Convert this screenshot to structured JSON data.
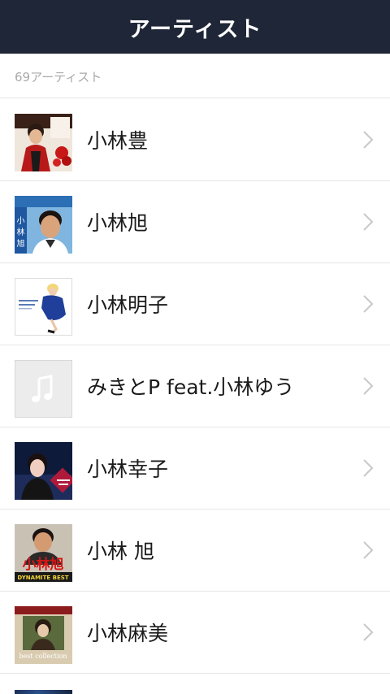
{
  "header": {
    "title": "アーティスト"
  },
  "summary": {
    "count_label": "69アーティスト"
  },
  "artists": [
    {
      "name": "小林豊",
      "thumb_icon": "album-cover-rose-icon"
    },
    {
      "name": "小林旭",
      "thumb_icon": "album-cover-portrait-icon"
    },
    {
      "name": "小林明子",
      "thumb_icon": "album-cover-figure-icon"
    },
    {
      "name": "みきとP feat.小林ゆう",
      "thumb_icon": "music-note-placeholder-icon"
    },
    {
      "name": "小林幸子",
      "thumb_icon": "album-cover-portrait-icon"
    },
    {
      "name": "小林 旭",
      "thumb_icon": "album-cover-dynamite-icon",
      "cover_text": [
        "小林旭",
        "DYNAMITE BEST"
      ]
    },
    {
      "name": "小林麻美",
      "thumb_icon": "album-cover-best-collection-icon",
      "cover_text": [
        "best collection"
      ]
    }
  ],
  "colors": {
    "header_bg": "#1f2637",
    "header_text": "#ffffff",
    "count_text": "#a9a9a9",
    "divider": "#e6e6e6",
    "chevron": "#c8c8c8"
  }
}
